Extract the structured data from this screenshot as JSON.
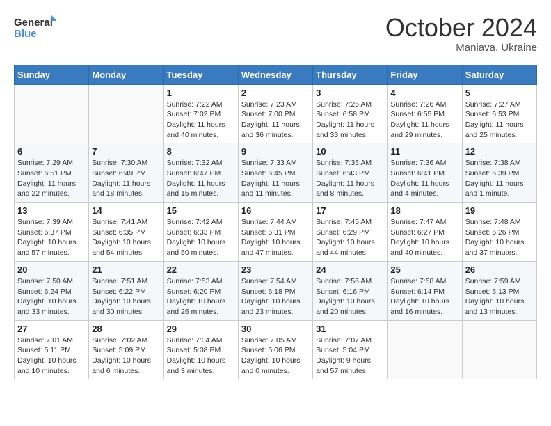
{
  "header": {
    "logo_general": "General",
    "logo_blue": "Blue",
    "month_title": "October 2024",
    "subtitle": "Maniava, Ukraine"
  },
  "weekdays": [
    "Sunday",
    "Monday",
    "Tuesday",
    "Wednesday",
    "Thursday",
    "Friday",
    "Saturday"
  ],
  "weeks": [
    [
      {
        "day": "",
        "sunrise": "",
        "sunset": "",
        "daylight": ""
      },
      {
        "day": "",
        "sunrise": "",
        "sunset": "",
        "daylight": ""
      },
      {
        "day": "1",
        "sunrise": "Sunrise: 7:22 AM",
        "sunset": "Sunset: 7:02 PM",
        "daylight": "Daylight: 11 hours and 40 minutes."
      },
      {
        "day": "2",
        "sunrise": "Sunrise: 7:23 AM",
        "sunset": "Sunset: 7:00 PM",
        "daylight": "Daylight: 11 hours and 36 minutes."
      },
      {
        "day": "3",
        "sunrise": "Sunrise: 7:25 AM",
        "sunset": "Sunset: 6:58 PM",
        "daylight": "Daylight: 11 hours and 33 minutes."
      },
      {
        "day": "4",
        "sunrise": "Sunrise: 7:26 AM",
        "sunset": "Sunset: 6:55 PM",
        "daylight": "Daylight: 11 hours and 29 minutes."
      },
      {
        "day": "5",
        "sunrise": "Sunrise: 7:27 AM",
        "sunset": "Sunset: 6:53 PM",
        "daylight": "Daylight: 11 hours and 25 minutes."
      }
    ],
    [
      {
        "day": "6",
        "sunrise": "Sunrise: 7:29 AM",
        "sunset": "Sunset: 6:51 PM",
        "daylight": "Daylight: 11 hours and 22 minutes."
      },
      {
        "day": "7",
        "sunrise": "Sunrise: 7:30 AM",
        "sunset": "Sunset: 6:49 PM",
        "daylight": "Daylight: 11 hours and 18 minutes."
      },
      {
        "day": "8",
        "sunrise": "Sunrise: 7:32 AM",
        "sunset": "Sunset: 6:47 PM",
        "daylight": "Daylight: 11 hours and 15 minutes."
      },
      {
        "day": "9",
        "sunrise": "Sunrise: 7:33 AM",
        "sunset": "Sunset: 6:45 PM",
        "daylight": "Daylight: 11 hours and 11 minutes."
      },
      {
        "day": "10",
        "sunrise": "Sunrise: 7:35 AM",
        "sunset": "Sunset: 6:43 PM",
        "daylight": "Daylight: 11 hours and 8 minutes."
      },
      {
        "day": "11",
        "sunrise": "Sunrise: 7:36 AM",
        "sunset": "Sunset: 6:41 PM",
        "daylight": "Daylight: 11 hours and 4 minutes."
      },
      {
        "day": "12",
        "sunrise": "Sunrise: 7:38 AM",
        "sunset": "Sunset: 6:39 PM",
        "daylight": "Daylight: 11 hours and 1 minute."
      }
    ],
    [
      {
        "day": "13",
        "sunrise": "Sunrise: 7:39 AM",
        "sunset": "Sunset: 6:37 PM",
        "daylight": "Daylight: 10 hours and 57 minutes."
      },
      {
        "day": "14",
        "sunrise": "Sunrise: 7:41 AM",
        "sunset": "Sunset: 6:35 PM",
        "daylight": "Daylight: 10 hours and 54 minutes."
      },
      {
        "day": "15",
        "sunrise": "Sunrise: 7:42 AM",
        "sunset": "Sunset: 6:33 PM",
        "daylight": "Daylight: 10 hours and 50 minutes."
      },
      {
        "day": "16",
        "sunrise": "Sunrise: 7:44 AM",
        "sunset": "Sunset: 6:31 PM",
        "daylight": "Daylight: 10 hours and 47 minutes."
      },
      {
        "day": "17",
        "sunrise": "Sunrise: 7:45 AM",
        "sunset": "Sunset: 6:29 PM",
        "daylight": "Daylight: 10 hours and 44 minutes."
      },
      {
        "day": "18",
        "sunrise": "Sunrise: 7:47 AM",
        "sunset": "Sunset: 6:27 PM",
        "daylight": "Daylight: 10 hours and 40 minutes."
      },
      {
        "day": "19",
        "sunrise": "Sunrise: 7:48 AM",
        "sunset": "Sunset: 6:26 PM",
        "daylight": "Daylight: 10 hours and 37 minutes."
      }
    ],
    [
      {
        "day": "20",
        "sunrise": "Sunrise: 7:50 AM",
        "sunset": "Sunset: 6:24 PM",
        "daylight": "Daylight: 10 hours and 33 minutes."
      },
      {
        "day": "21",
        "sunrise": "Sunrise: 7:51 AM",
        "sunset": "Sunset: 6:22 PM",
        "daylight": "Daylight: 10 hours and 30 minutes."
      },
      {
        "day": "22",
        "sunrise": "Sunrise: 7:53 AM",
        "sunset": "Sunset: 6:20 PM",
        "daylight": "Daylight: 10 hours and 26 minutes."
      },
      {
        "day": "23",
        "sunrise": "Sunrise: 7:54 AM",
        "sunset": "Sunset: 6:18 PM",
        "daylight": "Daylight: 10 hours and 23 minutes."
      },
      {
        "day": "24",
        "sunrise": "Sunrise: 7:56 AM",
        "sunset": "Sunset: 6:16 PM",
        "daylight": "Daylight: 10 hours and 20 minutes."
      },
      {
        "day": "25",
        "sunrise": "Sunrise: 7:58 AM",
        "sunset": "Sunset: 6:14 PM",
        "daylight": "Daylight: 10 hours and 16 minutes."
      },
      {
        "day": "26",
        "sunrise": "Sunrise: 7:59 AM",
        "sunset": "Sunset: 6:13 PM",
        "daylight": "Daylight: 10 hours and 13 minutes."
      }
    ],
    [
      {
        "day": "27",
        "sunrise": "Sunrise: 7:01 AM",
        "sunset": "Sunset: 5:11 PM",
        "daylight": "Daylight: 10 hours and 10 minutes."
      },
      {
        "day": "28",
        "sunrise": "Sunrise: 7:02 AM",
        "sunset": "Sunset: 5:09 PM",
        "daylight": "Daylight: 10 hours and 6 minutes."
      },
      {
        "day": "29",
        "sunrise": "Sunrise: 7:04 AM",
        "sunset": "Sunset: 5:08 PM",
        "daylight": "Daylight: 10 hours and 3 minutes."
      },
      {
        "day": "30",
        "sunrise": "Sunrise: 7:05 AM",
        "sunset": "Sunset: 5:06 PM",
        "daylight": "Daylight: 10 hours and 0 minutes."
      },
      {
        "day": "31",
        "sunrise": "Sunrise: 7:07 AM",
        "sunset": "Sunset: 5:04 PM",
        "daylight": "Daylight: 9 hours and 57 minutes."
      },
      {
        "day": "",
        "sunrise": "",
        "sunset": "",
        "daylight": ""
      },
      {
        "day": "",
        "sunrise": "",
        "sunset": "",
        "daylight": ""
      }
    ]
  ]
}
